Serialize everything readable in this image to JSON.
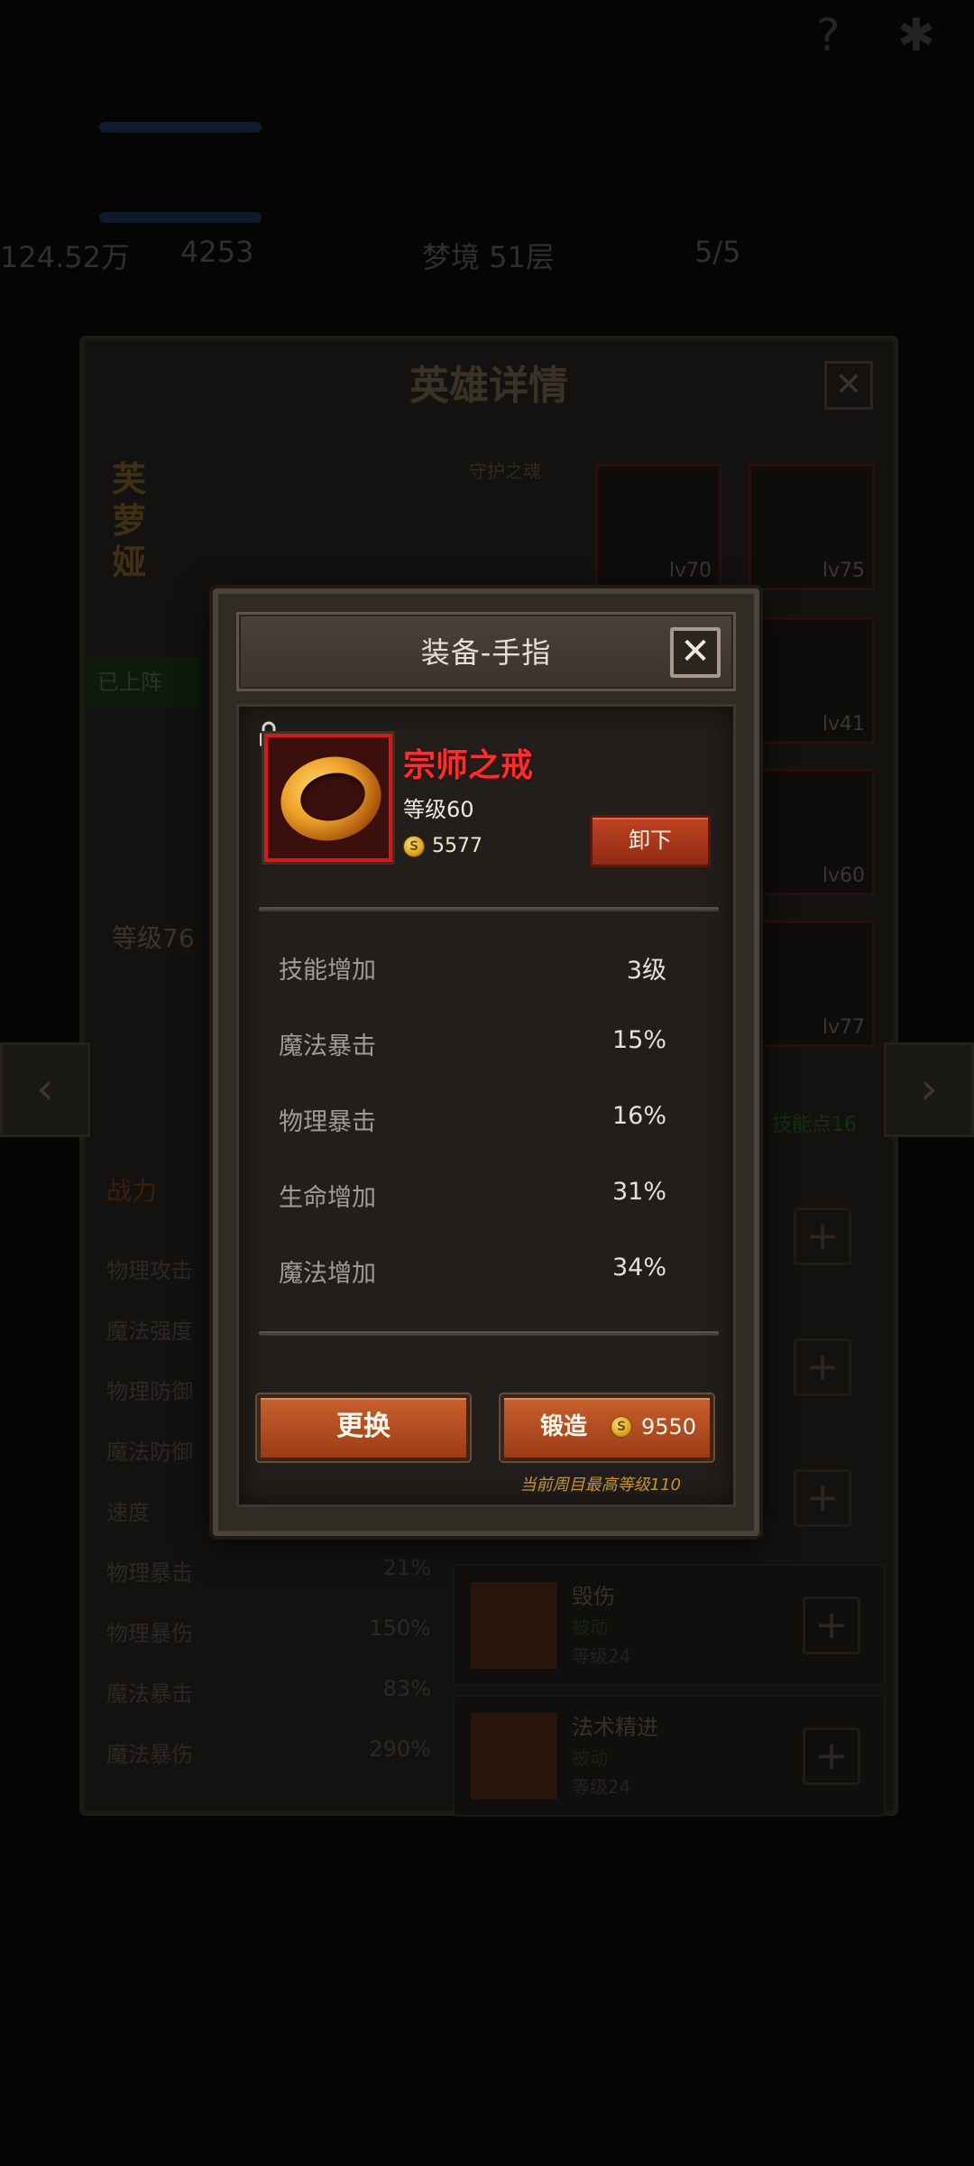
{
  "background": {
    "top_stats": {
      "gold": "124.52万",
      "gems": "4253",
      "dream_floor": "梦境 51层",
      "team": "5/5"
    },
    "panel_title": "英雄详情",
    "hero_name": "芙萝娅",
    "hero_badge": "已上阵",
    "soul_label": "守护之魂",
    "hero_level": "等级76",
    "equip_slots": [
      {
        "level": "lv70"
      },
      {
        "level": "lv75"
      },
      {
        "level": "lv41"
      },
      {
        "level": "lv60"
      },
      {
        "level": "lv77"
      }
    ],
    "skill_points": "技能点16",
    "stats_header": "战力",
    "stats": [
      {
        "label": "物理攻击",
        "value": ""
      },
      {
        "label": "魔法强度",
        "value": ""
      },
      {
        "label": "物理防御",
        "value": ""
      },
      {
        "label": "魔法防御",
        "value": ""
      },
      {
        "label": "速度",
        "value": ""
      },
      {
        "label": "物理暴击",
        "value": "21%"
      },
      {
        "label": "物理暴伤",
        "value": "150%"
      },
      {
        "label": "魔法暴击",
        "value": "83%"
      },
      {
        "label": "魔法暴伤",
        "value": "290%"
      }
    ],
    "skills": [
      {
        "name": "毁伤",
        "type": "被动",
        "level": "等级24"
      },
      {
        "name": "法术精进",
        "type": "被动",
        "level": "等级24"
      }
    ]
  },
  "modal": {
    "title": "装备-手指",
    "close": "✕",
    "item": {
      "name": "宗师之戒",
      "level": "等级60",
      "price": "5577"
    },
    "unequip_label": "卸下",
    "stats": [
      {
        "label": "技能增加",
        "value": "3级"
      },
      {
        "label": "魔法暴击",
        "value": "15%"
      },
      {
        "label": "物理暴击",
        "value": "16%"
      },
      {
        "label": "生命增加",
        "value": "31%"
      },
      {
        "label": "魔法增加",
        "value": "34%"
      }
    ],
    "replace_label": "更换",
    "forge_label": "锻造",
    "forge_cost": "9550",
    "max_level_note": "当前周目最高等级110",
    "coin_glyph": "S"
  },
  "colors": {
    "item_name": "#ff2c2c",
    "button_orange": "#c9602e",
    "note": "#c7922f"
  }
}
